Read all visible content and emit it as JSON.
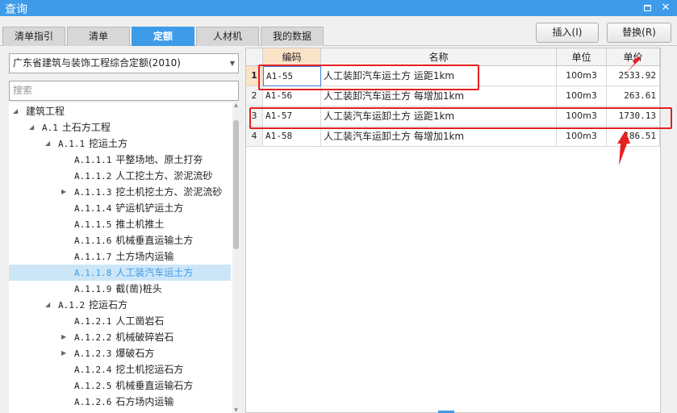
{
  "window": {
    "title": "查询"
  },
  "tabs": [
    "清单指引",
    "清单",
    "定额",
    "人材机",
    "我的数据"
  ],
  "buttons": {
    "insert": "插入(I)",
    "replace": "替换(R)"
  },
  "left": {
    "library": "广东省建筑与装饰工程综合定额(2010)",
    "search_placeholder": "搜索",
    "tree": [
      {
        "code": "",
        "label": "建筑工程",
        "expander": "expanded"
      },
      {
        "code": "A.1",
        "label": "土石方工程",
        "expander": "expanded"
      },
      {
        "code": "A.1.1",
        "label": "挖运土方",
        "expander": "expanded"
      },
      {
        "code": "A.1.1.1",
        "label": "平整场地、原土打夯",
        "expander": "none"
      },
      {
        "code": "A.1.1.2",
        "label": "人工挖土方、淤泥流砂",
        "expander": "none"
      },
      {
        "code": "A.1.1.3",
        "label": "挖土机挖土方、淤泥流砂",
        "expander": "collapsed"
      },
      {
        "code": "A.1.1.4",
        "label": "铲运机铲运土方",
        "expander": "none"
      },
      {
        "code": "A.1.1.5",
        "label": "推土机推土",
        "expander": "none"
      },
      {
        "code": "A.1.1.6",
        "label": "机械垂直运输土方",
        "expander": "none"
      },
      {
        "code": "A.1.1.7",
        "label": "土方场内运输",
        "expander": "none"
      },
      {
        "code": "A.1.1.8",
        "label": "人工装汽车运土方",
        "expander": "none"
      },
      {
        "code": "A.1.1.9",
        "label": "截(凿)桩头",
        "expander": "none"
      },
      {
        "code": "A.1.2",
        "label": "挖运石方",
        "expander": "expanded"
      },
      {
        "code": "A.1.2.1",
        "label": "人工凿岩石",
        "expander": "none"
      },
      {
        "code": "A.1.2.2",
        "label": "机械破碎岩石",
        "expander": "collapsed"
      },
      {
        "code": "A.1.2.3",
        "label": "爆破石方",
        "expander": "collapsed"
      },
      {
        "code": "A.1.2.4",
        "label": "挖土机挖运石方",
        "expander": "none"
      },
      {
        "code": "A.1.2.5",
        "label": "机械垂直运输石方",
        "expander": "none"
      },
      {
        "code": "A.1.2.6",
        "label": "石方场内运输",
        "expander": "none"
      }
    ]
  },
  "table": {
    "columns": [
      "",
      "编码",
      "名称",
      "单位",
      "单价"
    ],
    "rows": [
      {
        "index": "1",
        "code": "A1-55",
        "name": "人工装卸汽车运土方 运距1km",
        "unit": "100m3",
        "price": "2533.92"
      },
      {
        "index": "2",
        "code": "A1-56",
        "name": "人工装卸汽车运土方 每增加1km",
        "unit": "100m3",
        "price": "263.61"
      },
      {
        "index": "3",
        "code": "A1-57",
        "name": "人工装汽车运卸土方 运距1km",
        "unit": "100m3",
        "price": "1730.13"
      },
      {
        "index": "4",
        "code": "A1-58",
        "name": "人工装汽车运卸土方 每增加1km",
        "unit": "100m3",
        "price": "186.51"
      }
    ]
  },
  "colors": {
    "accent": "#3d9be9",
    "annotation": "#e52020",
    "selected_row": "#cde6f7"
  }
}
